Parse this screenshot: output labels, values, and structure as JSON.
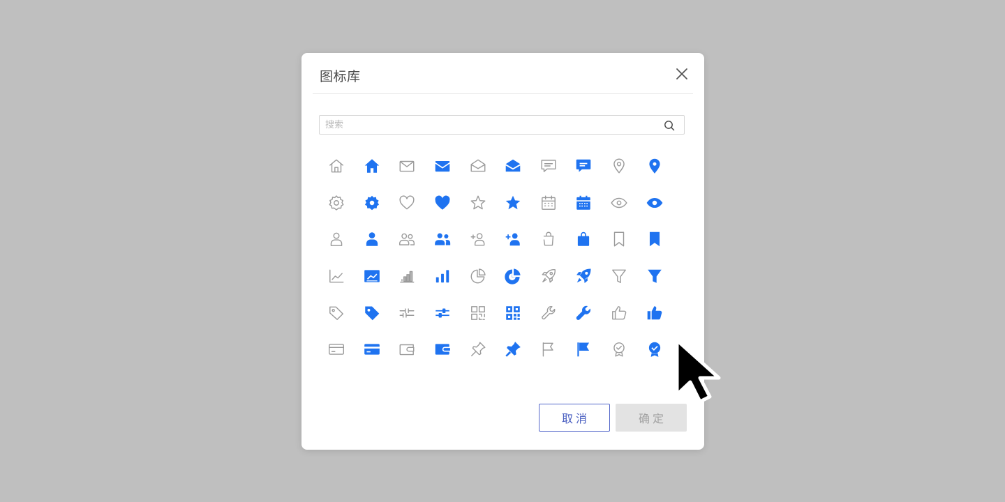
{
  "dialog": {
    "title": "图标库",
    "close_icon": "close-icon"
  },
  "search": {
    "placeholder": "搜索",
    "value": "",
    "icon": "search-icon"
  },
  "colors": {
    "outline_icon": "#9a9a9a",
    "filled_icon": "#1f73f0",
    "cancel_accent": "#4a5fc1",
    "confirm_disabled_bg": "#e3e3e3",
    "backdrop": "#bfbfbf"
  },
  "icons": [
    {
      "name": "home",
      "style": "outline"
    },
    {
      "name": "home",
      "style": "filled"
    },
    {
      "name": "mail",
      "style": "outline"
    },
    {
      "name": "mail",
      "style": "filled"
    },
    {
      "name": "mail-open",
      "style": "outline"
    },
    {
      "name": "mail-open",
      "style": "filled"
    },
    {
      "name": "message",
      "style": "outline"
    },
    {
      "name": "message",
      "style": "filled"
    },
    {
      "name": "location",
      "style": "outline"
    },
    {
      "name": "location",
      "style": "filled"
    },
    {
      "name": "settings",
      "style": "outline"
    },
    {
      "name": "settings",
      "style": "filled"
    },
    {
      "name": "heart",
      "style": "outline"
    },
    {
      "name": "heart",
      "style": "filled"
    },
    {
      "name": "star",
      "style": "outline"
    },
    {
      "name": "star",
      "style": "filled"
    },
    {
      "name": "calendar",
      "style": "outline"
    },
    {
      "name": "calendar",
      "style": "filled"
    },
    {
      "name": "eye",
      "style": "outline"
    },
    {
      "name": "eye",
      "style": "filled"
    },
    {
      "name": "user",
      "style": "outline"
    },
    {
      "name": "user",
      "style": "filled"
    },
    {
      "name": "users",
      "style": "outline"
    },
    {
      "name": "users",
      "style": "filled"
    },
    {
      "name": "user-add",
      "style": "outline"
    },
    {
      "name": "user-add",
      "style": "filled"
    },
    {
      "name": "bag",
      "style": "outline"
    },
    {
      "name": "bag",
      "style": "filled"
    },
    {
      "name": "bookmark",
      "style": "outline"
    },
    {
      "name": "bookmark",
      "style": "filled"
    },
    {
      "name": "line-chart",
      "style": "outline"
    },
    {
      "name": "line-chart",
      "style": "filled"
    },
    {
      "name": "bar-chart",
      "style": "outline"
    },
    {
      "name": "bar-chart",
      "style": "filled"
    },
    {
      "name": "pie-chart",
      "style": "outline"
    },
    {
      "name": "pie-chart",
      "style": "filled"
    },
    {
      "name": "rocket",
      "style": "outline"
    },
    {
      "name": "rocket",
      "style": "filled"
    },
    {
      "name": "filter",
      "style": "outline"
    },
    {
      "name": "filter",
      "style": "filled"
    },
    {
      "name": "tag",
      "style": "outline"
    },
    {
      "name": "tag",
      "style": "filled"
    },
    {
      "name": "sliders",
      "style": "outline"
    },
    {
      "name": "sliders",
      "style": "filled"
    },
    {
      "name": "qrcode",
      "style": "outline"
    },
    {
      "name": "qrcode",
      "style": "filled"
    },
    {
      "name": "wrench",
      "style": "outline"
    },
    {
      "name": "wrench",
      "style": "filled"
    },
    {
      "name": "thumbs-up",
      "style": "outline"
    },
    {
      "name": "thumbs-up",
      "style": "filled"
    },
    {
      "name": "credit-card",
      "style": "outline"
    },
    {
      "name": "credit-card",
      "style": "filled"
    },
    {
      "name": "wallet",
      "style": "outline"
    },
    {
      "name": "wallet",
      "style": "filled"
    },
    {
      "name": "pin",
      "style": "outline"
    },
    {
      "name": "pin",
      "style": "filled"
    },
    {
      "name": "flag",
      "style": "outline"
    },
    {
      "name": "flag",
      "style": "filled"
    },
    {
      "name": "badge",
      "style": "outline"
    },
    {
      "name": "badge",
      "style": "filled"
    }
  ],
  "footer": {
    "cancel_label": "取消",
    "confirm_label": "确定",
    "confirm_disabled": true
  }
}
